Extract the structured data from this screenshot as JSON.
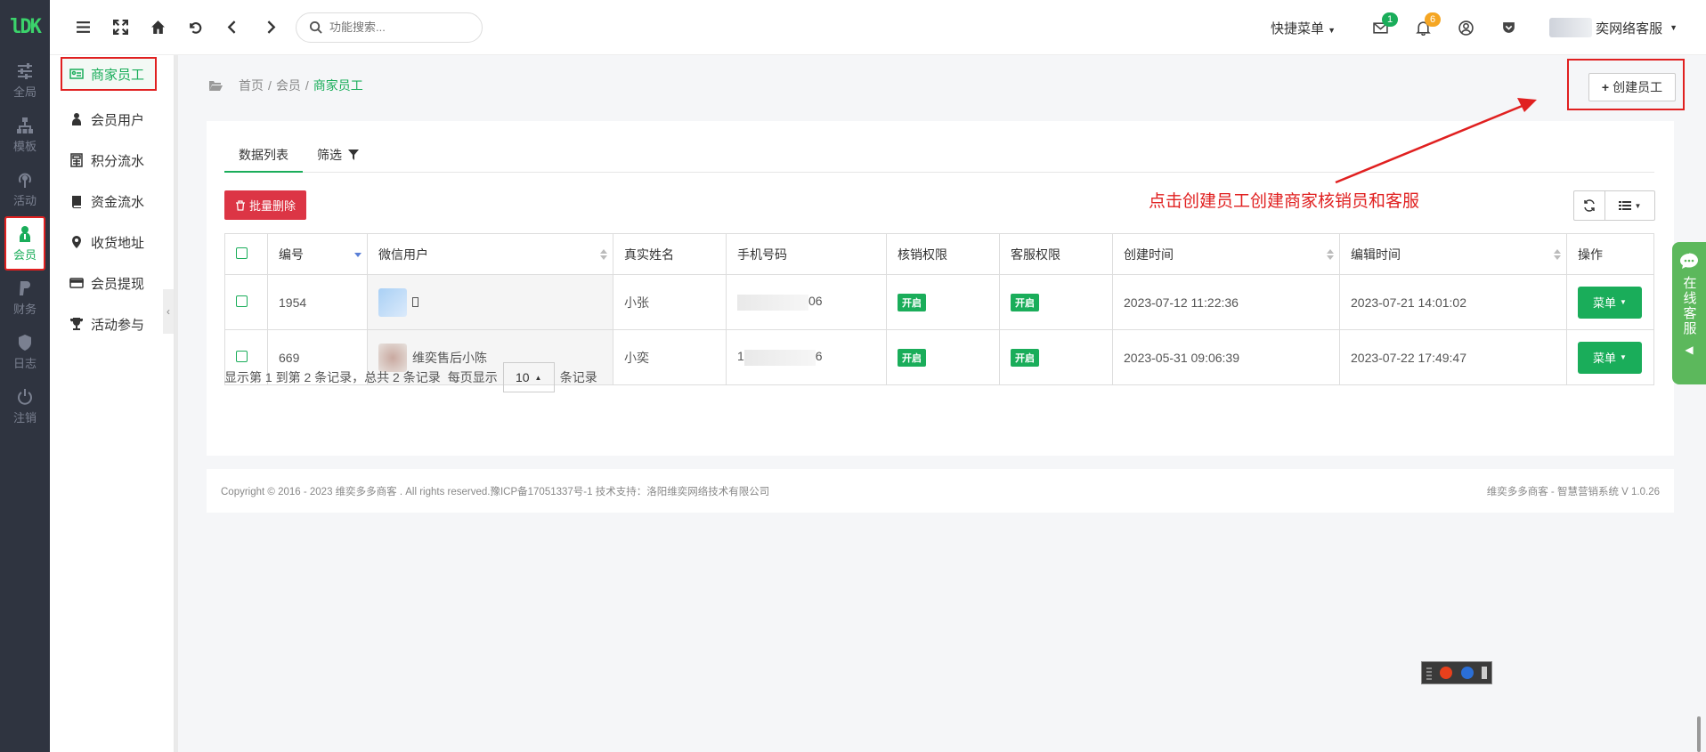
{
  "logo": {
    "text": "lDK",
    "color": "#3bd36b"
  },
  "rail": {
    "items": [
      {
        "label": "全局",
        "icon": "sliders-icon",
        "active": false
      },
      {
        "label": "模板",
        "icon": "sitemap-icon",
        "active": false
      },
      {
        "label": "活动",
        "icon": "broadcast-icon",
        "active": false
      },
      {
        "label": "会员",
        "icon": "user-tie-icon",
        "active": true
      },
      {
        "label": "财务",
        "icon": "paypal-icon",
        "active": false
      },
      {
        "label": "日志",
        "icon": "shield-icon",
        "active": false
      },
      {
        "label": "注销",
        "icon": "power-icon",
        "active": false
      }
    ]
  },
  "submenu": {
    "items": [
      {
        "label": "商家员工",
        "icon": "id-card-icon",
        "active": true
      },
      {
        "label": "会员用户",
        "icon": "user-icon",
        "active": false
      },
      {
        "label": "积分流水",
        "icon": "calculator-icon",
        "active": false
      },
      {
        "label": "资金流水",
        "icon": "book-icon",
        "active": false
      },
      {
        "label": "收货地址",
        "icon": "map-marker-icon",
        "active": false
      },
      {
        "label": "会员提现",
        "icon": "credit-card-icon",
        "active": false
      },
      {
        "label": "活动参与",
        "icon": "trophy-icon",
        "active": false
      }
    ]
  },
  "topbar": {
    "search_placeholder": "功能搜索...",
    "quick_menu": "快捷菜单",
    "mail_count": "1",
    "notice_count": "6",
    "user_name": "奕网络客服"
  },
  "breadcrumb": {
    "home": "首页",
    "level1": "会员",
    "current": "商家员工"
  },
  "create_button": "创建员工",
  "annotation": "点击创建员工创建商家核销员和客服",
  "tabs": {
    "list": "数据列表",
    "filter": "筛选"
  },
  "batch_delete": "批量删除",
  "table": {
    "headers": [
      "编号",
      "微信用户",
      "真实姓名",
      "手机号码",
      "核销权限",
      "客服权限",
      "创建时间",
      "编辑时间",
      "操作"
    ],
    "rows": [
      {
        "id": "1954",
        "wechat": "",
        "real_name": "小张",
        "phone_tail": "06",
        "verify": "开启",
        "service": "开启",
        "created": "2023-07-12 11:22:36",
        "edited": "2023-07-21 14:01:02",
        "action": "菜单"
      },
      {
        "id": "669",
        "wechat": "维奕售后小陈",
        "real_name": "小奕",
        "phone_head": "1",
        "phone_tail": "6",
        "verify": "开启",
        "service": "开启",
        "created": "2023-05-31 09:06:39",
        "edited": "2023-07-22 17:49:47",
        "action": "菜单"
      }
    ]
  },
  "pager": {
    "summary": "显示第 1 到第 2 条记录，总共 2 条记录",
    "per_page_label": "每页显示",
    "page_size": "10",
    "records_label": "条记录"
  },
  "footer": {
    "left": "Copyright © 2016 - 2023 维奕多多商客 . All rights reserved.豫ICP备17051337号-1 技术支持：洛阳维奕网络技术有限公司",
    "right": "维奕多多商客 - 智慧营销系统 V 1.0.26"
  },
  "online_service": "在线客服",
  "colors": {
    "accent": "#1aad5a",
    "danger": "#dc3545",
    "annotation": "#e02020"
  }
}
